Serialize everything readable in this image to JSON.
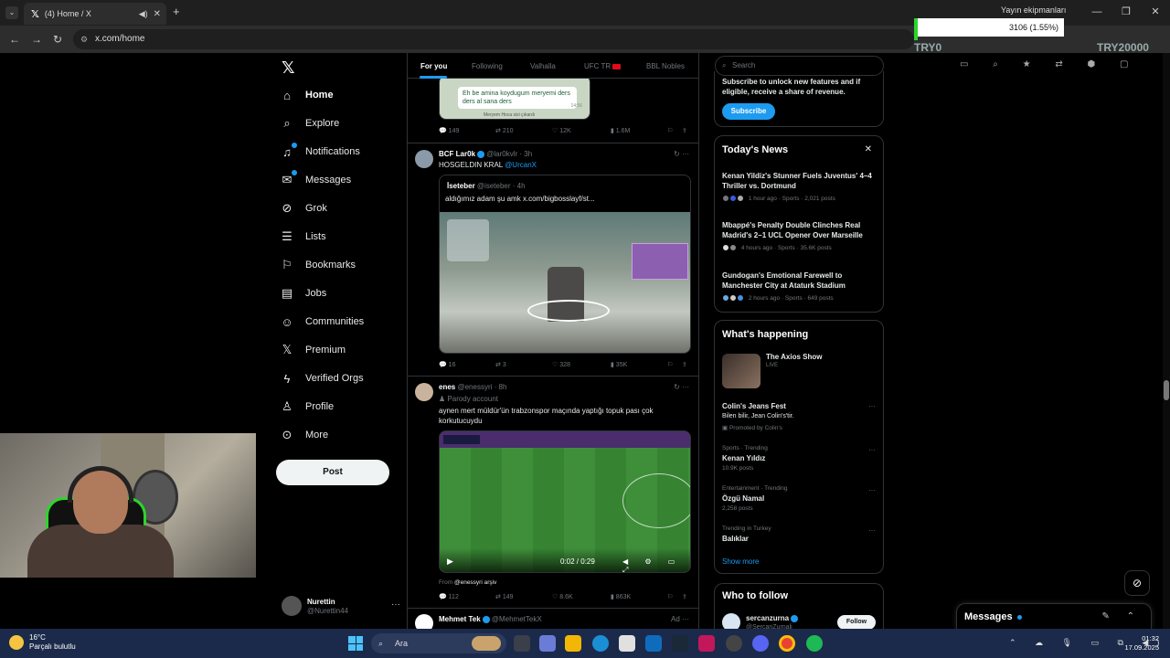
{
  "browser": {
    "tab_title": "(4) Home / X",
    "url": "x.com/home",
    "yayin_label": "Yayın ekipmanları",
    "bitrate": "3106 (1.55%)",
    "overlay_left": "TRY0",
    "overlay_right": "TRY20000"
  },
  "nav": {
    "items": [
      {
        "label": "Home",
        "icon": "home-icon"
      },
      {
        "label": "Explore",
        "icon": "search-icon"
      },
      {
        "label": "Notifications",
        "icon": "bell-icon"
      },
      {
        "label": "Messages",
        "icon": "mail-icon"
      },
      {
        "label": "Grok",
        "icon": "grok-icon"
      },
      {
        "label": "Lists",
        "icon": "list-icon"
      },
      {
        "label": "Bookmarks",
        "icon": "bookmark-icon"
      },
      {
        "label": "Jobs",
        "icon": "briefcase-icon"
      },
      {
        "label": "Communities",
        "icon": "people-icon"
      },
      {
        "label": "Premium",
        "icon": "x-icon"
      },
      {
        "label": "Verified Orgs",
        "icon": "lightning-icon"
      },
      {
        "label": "Profile",
        "icon": "person-icon"
      },
      {
        "label": "More",
        "icon": "more-circle-icon"
      }
    ],
    "post_label": "Post",
    "account_name": "Nurettin",
    "account_handle": "@Nurettin44"
  },
  "timeline": {
    "tabs": [
      "For you",
      "Following",
      "Valhalla",
      "UFC TR",
      "BBL Nobles"
    ],
    "tweet0": {
      "quoted_text": "Eh be amina koydugum meryemi ders ders al sana ders",
      "quoted_time": "14:56",
      "quoted_sender": "Meryem Hoca sizi çıkardı",
      "replies": "149",
      "retweets": "210",
      "likes": "12K",
      "views": "1.6M"
    },
    "tweet1": {
      "name": "BCF Lar0k",
      "meta": "@lar0kvlr · 3h",
      "text": "HOSGELDIN KRAL",
      "mention": "@UrcanX",
      "quote_name": "İseteber",
      "quote_meta": "@iseteber · 4h",
      "quote_text": "aldığımız adam şu amk",
      "quote_link": "x.com/bigbosslayf/st...",
      "replies": "16",
      "retweets": "3",
      "likes": "328",
      "views": "35K"
    },
    "tweet2": {
      "name": "enes",
      "meta": "@enessyri · 8h",
      "parody": "Parody account",
      "text": "aynen mert müldür'ün trabzonspor maçında yaptığı topuk pası çok korkutucuydu",
      "video_time": "0:02 / 0:29",
      "from_label": "From",
      "from_account": "@enessyri arşiv",
      "replies": "112",
      "retweets": "149",
      "likes": "8.6K",
      "views": "863K"
    },
    "tweet3": {
      "name": "Mehmet Tek",
      "meta": "@MehmetTekX",
      "ad": "Ad"
    }
  },
  "sidebar": {
    "search_placeholder": "Search",
    "premium_text": "Subscribe to unlock new features and if eligible, receive a share of revenue.",
    "subscribe_label": "Subscribe",
    "news_title": "Today's News",
    "news": [
      {
        "title": "Kenan Yildiz's Stunner Fuels Juventus' 4–4 Thriller vs. Dortmund",
        "meta": "1 hour ago · Sports · 2,021 posts"
      },
      {
        "title": "Mbappé's Penalty Double Clinches Real Madrid's 2–1 UCL Opener Over Marseille",
        "meta": "4 hours ago · Sports · 35.6K posts"
      },
      {
        "title": "Gundogan's Emotional Farewell to Manchester City at Ataturk Stadium",
        "meta": "2 hours ago · Sports · 649 posts"
      }
    ],
    "happening_title": "What's happening",
    "axios_title": "The Axios Show",
    "axios_live": "LIVE",
    "promo_title": "Colin's Jeans Fest",
    "promo_sub": "Bilen bilir, Jean Colin's'tir.",
    "promo_by": "Promoted by Colin's",
    "trends": [
      {
        "cat": "Sports · Trending",
        "name": "Kenan Yıldız",
        "sub": "10.9K posts"
      },
      {
        "cat": "Entertainment · Trending",
        "name": "Özgü Namal",
        "sub": "2,258 posts"
      },
      {
        "cat": "Trending in Turkey",
        "name": "Balıklar",
        "sub": ""
      }
    ],
    "show_more": "Show more",
    "who_title": "Who to follow",
    "who_name": "sercanzurna",
    "who_handle": "@SercanZurnali",
    "follow_label": "Follow"
  },
  "messages_drawer": {
    "title": "Messages"
  },
  "taskbar": {
    "temp": "16°C",
    "weather": "Parçalı bulutlu",
    "search": "Ara",
    "time": "01:32",
    "date": "17.09.2025"
  }
}
